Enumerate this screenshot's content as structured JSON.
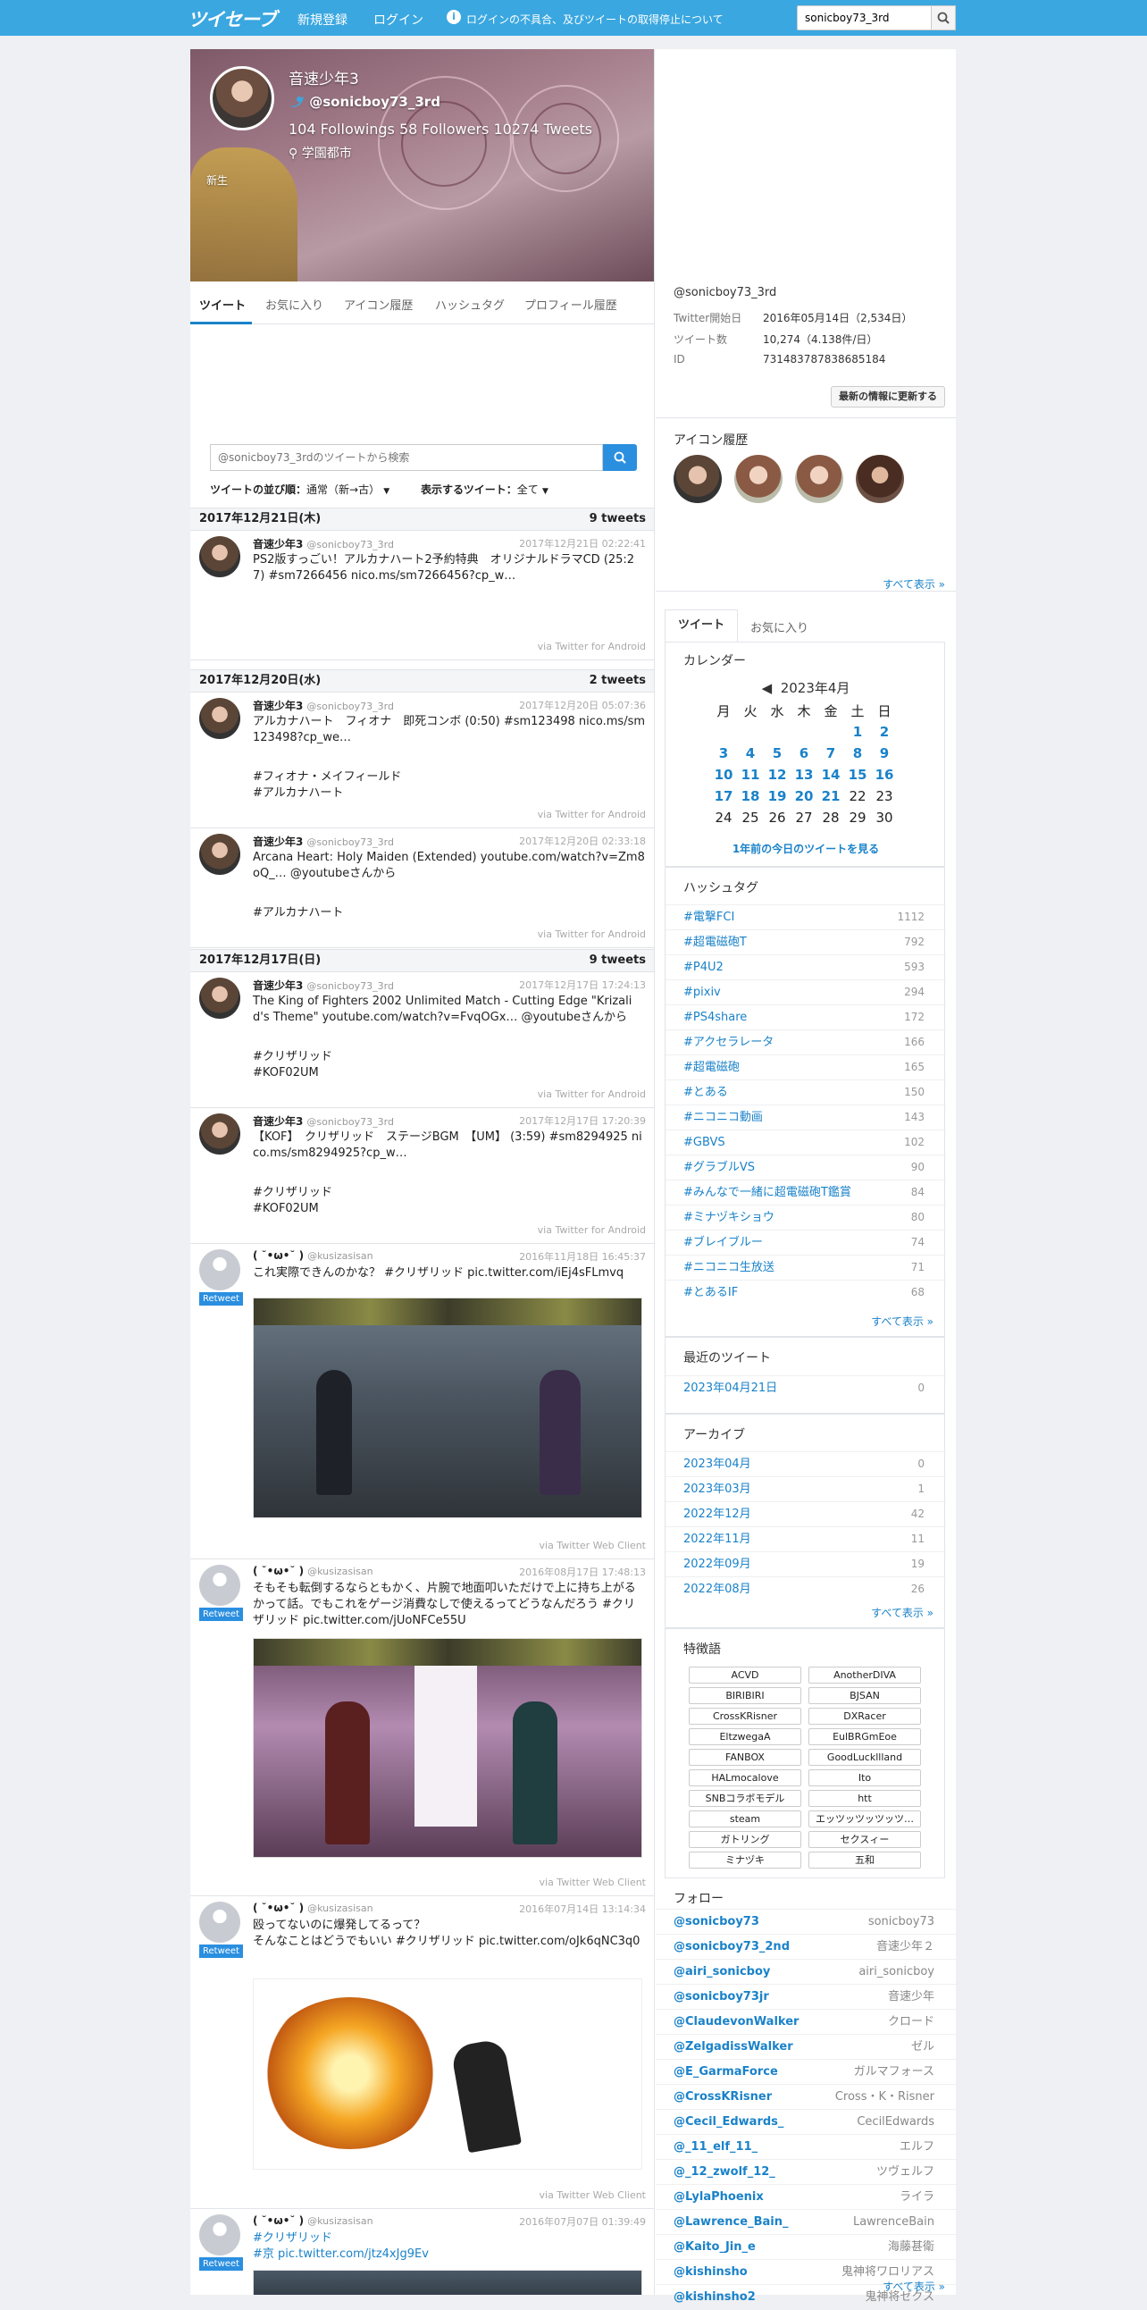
{
  "header": {
    "logo": "ツイセーブ",
    "register": "新規登録",
    "login": "ログイン",
    "notice": "ログインの不具合、及びツイートの取得停止について",
    "search_value": "sonicboy73_3rd"
  },
  "profile": {
    "name": "音速少年3",
    "handle": "@sonicboy73_3rd",
    "stats": "104 Followings  58 Followers  10274 Tweets",
    "location": "学園都市",
    "tag": "新生",
    "tabs": [
      "ツイート",
      "お気に入り",
      "アイコン履歴",
      "ハッシュタグ",
      "プロフィール履歴"
    ]
  },
  "tweet_search": {
    "placeholder": "@sonicboy73_3rdのツイートから検索"
  },
  "sort": {
    "order_label": "ツイートの並び順：",
    "order_value": "通常（新→古）",
    "show_label": "表示するツイート：",
    "show_value": "全て"
  },
  "days": [
    {
      "date": "2017年12月21日(木)",
      "count": "9 tweets"
    },
    {
      "date": "2017年12月20日(水)",
      "count": "2 tweets"
    },
    {
      "date": "2017年12月17日(日)",
      "count": "9 tweets"
    }
  ],
  "tweets": [
    {
      "name": "音速少年3",
      "handle": "@sonicboy73_3rd",
      "date": "2017年12月21日 02:22:41",
      "text": "PS2版すっごい！アルカナハート2予約特典　オリジナルドラマCD (25:27) #sm7266456 nico.ms/sm7266456?cp_w…",
      "via": "via Twitter for Android"
    },
    {
      "name": "音速少年3",
      "handle": "@sonicboy73_3rd",
      "date": "2017年12月20日 05:07:36",
      "text": "アルカナハート　フィオナ　即死コンボ (0:50) #sm123498 nico.ms/sm123498?cp_we…",
      "tags": [
        "#フィオナ・メイフィールド",
        "#アルカナハート"
      ],
      "via": "via Twitter for Android"
    },
    {
      "name": "音速少年3",
      "handle": "@sonicboy73_3rd",
      "date": "2017年12月20日 02:33:18",
      "text": "Arcana Heart: Holy Maiden (Extended) youtube.com/watch?v=Zm8oQ_… @youtubeさんから",
      "tags": [
        "#アルカナハート"
      ],
      "via": "via Twitter for Android"
    },
    {
      "name": "音速少年3",
      "handle": "@sonicboy73_3rd",
      "date": "2017年12月17日 17:24:13",
      "text": "The King of Fighters 2002 Unlimited Match - Cutting Edge \"Krizalid's Theme\" youtube.com/watch?v=FvqOGx… @youtubeさんから",
      "tags": [
        "#クリザリッド",
        "#KOF02UM"
      ],
      "via": "via Twitter for Android"
    },
    {
      "name": "音速少年3",
      "handle": "@sonicboy73_3rd",
      "date": "2017年12月17日 17:20:39",
      "text": "【KOF】　クリザリッド　ステージBGM　【UM】 (3:59) #sm8294925 nico.ms/sm8294925?cp_w…",
      "tags": [
        "#クリザリッド",
        "#KOF02UM"
      ],
      "via": "via Twitter for Android"
    },
    {
      "name": "( ˘•ω•˘ )",
      "handle": "@kusizasisan",
      "date": "2016年11月18日 16:45:37",
      "text": "これ実際できんのかな？ #クリザリッド pic.twitter.com/iEj4sFLmvq",
      "retweet": "Retweet",
      "via": "via Twitter Web Client"
    },
    {
      "name": "( ˘•ω•˘ )",
      "handle": "@kusizasisan",
      "date": "2016年08月17日 17:48:13",
      "text": "そもそも転倒するならともかく、片腕で地面叩いただけで上に持ち上がるかって話。でもこれをゲージ消費なしで使えるってどうなんだろう #クリザリッド pic.twitter.com/jUoNFCe55U",
      "retweet": "Retweet",
      "via": "via Twitter Web Client"
    },
    {
      "name": "( ˘•ω•˘ )",
      "handle": "@kusizasisan",
      "date": "2016年07月14日 13:14:34",
      "text": "殴ってないのに爆発してるって？\nそんなことはどうでもいい #クリザリッド pic.twitter.com/oJk6qNC3q0",
      "retweet": "Retweet",
      "via": "via Twitter Web Client"
    },
    {
      "name": "( ˘•ω•˘ )",
      "handle": "@kusizasisan",
      "date": "2016年07月07日 01:39:49",
      "text": "#クリザリッド\n#京 pic.twitter.com/jtz4xJg9Ev",
      "retweet": "Retweet"
    }
  ],
  "account": {
    "handle": "@sonicboy73_3rd",
    "rows": [
      [
        "Twitter開始日",
        "2016年05月14日（2,534日）"
      ],
      [
        "ツイート数",
        "10,274（4.138件/日）"
      ],
      [
        "ID",
        "731483787838685184"
      ]
    ],
    "refresh": "最新の情報に更新する"
  },
  "icon_history": {
    "title": "アイコン履歴",
    "more": "すべて表示 »"
  },
  "side_tabs": [
    "ツイート",
    "お気に入り"
  ],
  "calendar": {
    "title": "カレンダー",
    "month": "2023年4月",
    "prev": "◀",
    "weekdays": [
      "月",
      "火",
      "水",
      "木",
      "金",
      "土",
      "日"
    ],
    "weeks": [
      [
        "",
        "",
        "",
        "",
        "",
        "1",
        "2"
      ],
      [
        "3",
        "4",
        "5",
        "6",
        "7",
        "8",
        "9"
      ],
      [
        "10",
        "11",
        "12",
        "13",
        "14",
        "15",
        "16"
      ],
      [
        "17",
        "18",
        "19",
        "20",
        "21",
        "22",
        "23"
      ],
      [
        "24",
        "25",
        "26",
        "27",
        "28",
        "29",
        "30"
      ]
    ],
    "link": "1年前の今日のツイートを見る"
  },
  "hashtags": {
    "title": "ハッシュタグ",
    "more": "すべて表示 »",
    "items": [
      [
        "#電撃FCI",
        "1112"
      ],
      [
        "#超電磁砲T",
        "792"
      ],
      [
        "#P4U2",
        "593"
      ],
      [
        "#pixiv",
        "294"
      ],
      [
        "#PS4share",
        "172"
      ],
      [
        "#アクセラレータ",
        "166"
      ],
      [
        "#超電磁砲",
        "165"
      ],
      [
        "#とある",
        "150"
      ],
      [
        "#ニコニコ動画",
        "143"
      ],
      [
        "#GBVS",
        "102"
      ],
      [
        "#グラブルVS",
        "90"
      ],
      [
        "#みんなで一緒に超電磁砲T鑑賞",
        "84"
      ],
      [
        "#ミナヅキショウ",
        "80"
      ],
      [
        "#ブレイブルー",
        "74"
      ],
      [
        "#ニコニコ生放送",
        "71"
      ],
      [
        "#とあるIF",
        "68"
      ]
    ]
  },
  "recent": {
    "title": "最近のツイート",
    "date": "2023年04月21日",
    "count": "0"
  },
  "archive": {
    "title": "アーカイブ",
    "more": "すべて表示 »",
    "items": [
      [
        "2023年04月",
        "0"
      ],
      [
        "2023年03月",
        "1"
      ],
      [
        "2022年12月",
        "42"
      ],
      [
        "2022年11月",
        "11"
      ],
      [
        "2022年09月",
        "19"
      ],
      [
        "2022年08月",
        "26"
      ]
    ]
  },
  "features": {
    "title": "特徴語",
    "items": [
      "ACVD",
      "AnotherDIVA",
      "BIRIBIRI",
      "BJSAN",
      "CrossKRisner",
      "DXRacer",
      "EltzwegaA",
      "EulBRGmEoe",
      "FANBOX",
      "GoodLuckllland",
      "HALmocalove",
      "Ito",
      "SNBコラボモデル",
      "htt",
      "steam",
      "エッツッツッツッツ…",
      "ガトリング",
      "セクスィー",
      "ミナヅキ",
      "五和"
    ]
  },
  "follow": {
    "title": "フォロー",
    "more": "すべて表示 »",
    "items": [
      [
        "@sonicboy73",
        "sonicboy73"
      ],
      [
        "@sonicboy73_2nd",
        "音速少年２"
      ],
      [
        "@airi_sonicboy",
        "airi_sonicboy"
      ],
      [
        "@sonicboy73jr",
        "音速少年"
      ],
      [
        "@ClaudevonWalker",
        "クロード"
      ],
      [
        "@ZelgadissWalker",
        "ゼル"
      ],
      [
        "@E_GarmaForce",
        "ガルマフォース"
      ],
      [
        "@CrossKRisner",
        "Cross・K・Risner"
      ],
      [
        "@Cecil_Edwards_",
        "CecilEdwards"
      ],
      [
        "@_11_elf_11_",
        "エルフ"
      ],
      [
        "@_12_zwolf_12_",
        "ツヴェルフ"
      ],
      [
        "@LylaPhoenix",
        "ライラ"
      ],
      [
        "@Lawrence_Bain_",
        "LawrenceBain"
      ],
      [
        "@Kaito_Jin_e",
        "海藤甚衛"
      ],
      [
        "@kishinsho",
        "鬼神将ワロリアス"
      ],
      [
        "@kishinsho2",
        "鬼神将ゼクス"
      ]
    ]
  }
}
